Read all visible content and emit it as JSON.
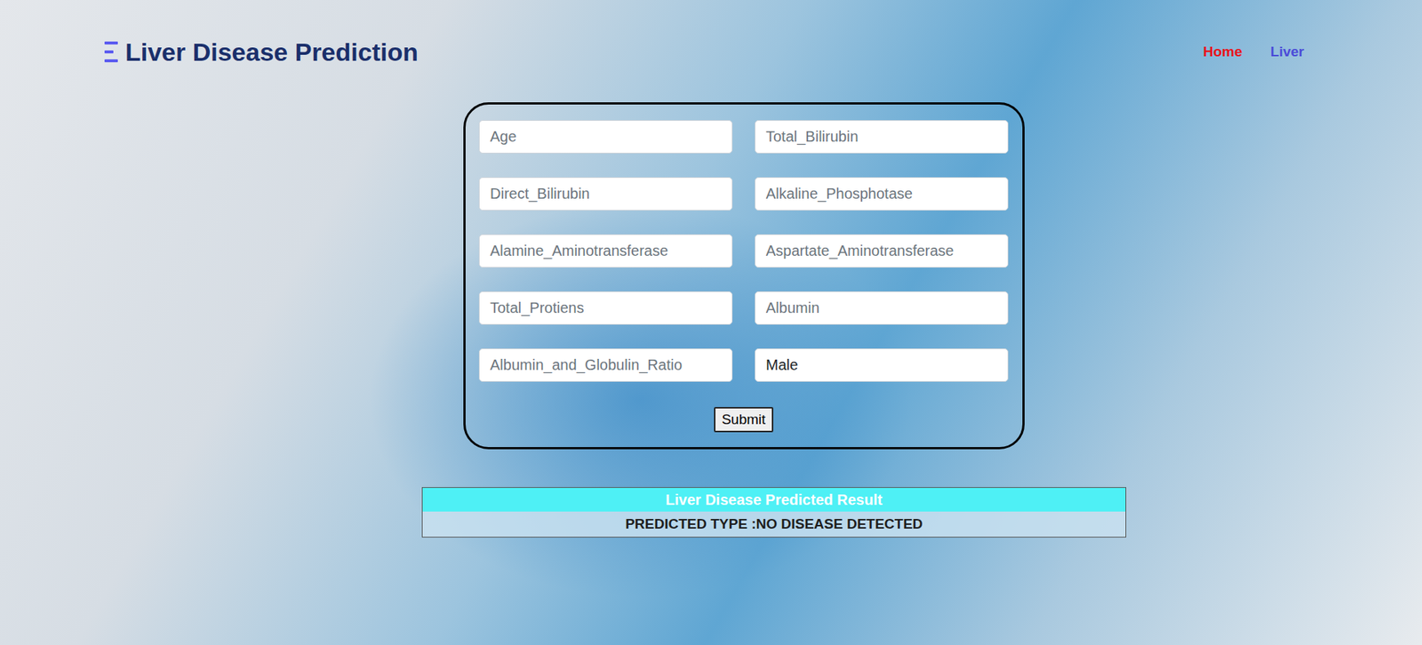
{
  "header": {
    "title": "Liver Disease Prediction"
  },
  "nav": [
    {
      "label": "Home",
      "selected": true
    },
    {
      "label": "Liver",
      "selected": false
    }
  ],
  "form": {
    "fields": [
      {
        "kind": "text",
        "placeholder": "Age",
        "value": ""
      },
      {
        "kind": "text",
        "placeholder": "Total_Bilirubin",
        "value": ""
      },
      {
        "kind": "text",
        "placeholder": "Direct_Bilirubin",
        "value": ""
      },
      {
        "kind": "text",
        "placeholder": "Alkaline_Phosphotase",
        "value": ""
      },
      {
        "kind": "text",
        "placeholder": "Alamine_Aminotransferase",
        "value": ""
      },
      {
        "kind": "text",
        "placeholder": "Aspartate_Aminotransferase",
        "value": ""
      },
      {
        "kind": "text",
        "placeholder": "Total_Protiens",
        "value": ""
      },
      {
        "kind": "text",
        "placeholder": "Albumin",
        "value": ""
      },
      {
        "kind": "text",
        "placeholder": "Albumin_and_Globulin_Ratio",
        "value": ""
      },
      {
        "kind": "select",
        "placeholder": "",
        "value": "Male"
      }
    ],
    "submit": "Submit"
  },
  "result": {
    "title": "Liver Disease Predicted Result",
    "text": "PREDICTED TYPE :NO DISEASE DETECTED"
  }
}
